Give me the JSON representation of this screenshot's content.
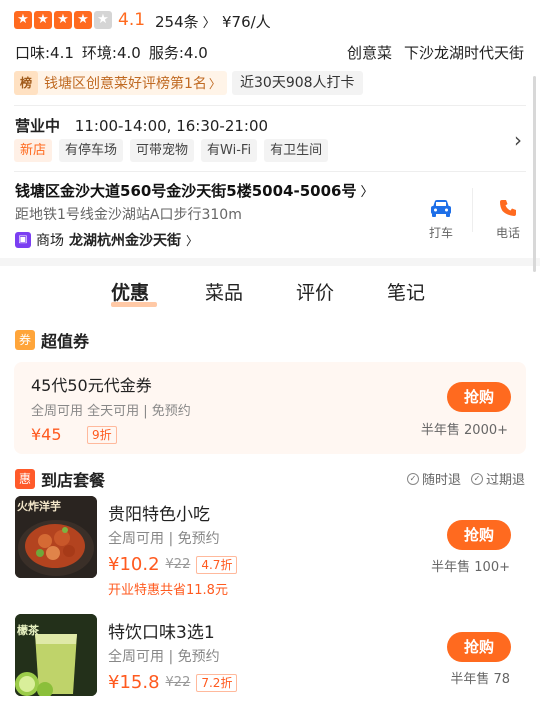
{
  "header": {
    "rating": "4.1",
    "stars_filled": 4,
    "stars_total": 5,
    "review_count": "254条",
    "price_avg": "¥76/人",
    "scores": [
      "口味:4.1",
      "环境:4.0",
      "服务:4.0"
    ],
    "category": "创意菜",
    "district": "下沙龙湖时代天街"
  },
  "ranking": {
    "icon_label": "榜",
    "text": "钱塘区创意菜好评榜第1名",
    "checkin": "近30天908人打卡"
  },
  "hours": {
    "status": "营业中",
    "time": "11:00-14:00, 16:30-21:00",
    "facilities": [
      "新店",
      "有停车场",
      "可带宠物",
      "有Wi-Fi",
      "有卫生间"
    ]
  },
  "address": {
    "text": "钱塘区金沙大道560号金沙天街5楼5004-5006号",
    "distance": "距地铁1号线金沙湖站A口步行310m",
    "mall_prefix": "商场",
    "mall_name": "龙湖杭州金沙天街",
    "actions": {
      "taxi": "打车",
      "phone": "电话"
    }
  },
  "tabs": [
    "优惠",
    "菜品",
    "评价",
    "笔记"
  ],
  "voucher_section": {
    "icon_label": "券",
    "title": "超值券",
    "card": {
      "title": "45代50元代金券",
      "sub": "全周可用 全天可用 | 免预约",
      "price": "¥45",
      "discount": "9折",
      "button": "抢购",
      "sold": "半年售 2000+"
    }
  },
  "package_section": {
    "icon_label": "惠",
    "title": "到店套餐",
    "policies": [
      "随时退",
      "过期退"
    ],
    "items": [
      {
        "title": "贵阳特色小吃",
        "sub": "全周可用 | 免预约",
        "price": "¥10.2",
        "old_price": "¥22",
        "discount": "4.7折",
        "promo": "开业特惠共省11.8元",
        "button": "抢购",
        "sold": "半年售 100+",
        "thumb_text": "火炸洋芋"
      },
      {
        "title": "特饮口味3选1",
        "sub": "全周可用 | 免预约",
        "price": "¥15.8",
        "old_price": "¥22",
        "discount": "7.2折",
        "button": "抢购",
        "sold": "半年售 78",
        "thumb_text": "檬茶"
      }
    ]
  },
  "colors": {
    "accent": "#ff6a1f",
    "price": "#ff5a1f",
    "ranking_text": "#c06a22",
    "mall_icon": "#7b3ff2",
    "taxi_icon": "#1e6fe8"
  }
}
